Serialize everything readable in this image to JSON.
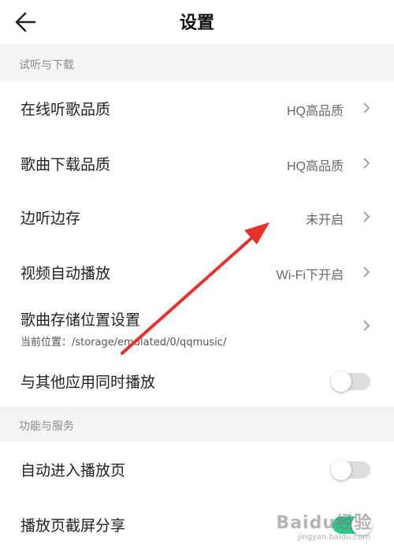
{
  "header": {
    "back_icon": "arrow-left-icon",
    "title": "设置"
  },
  "sections": [
    {
      "label": "试听与下载",
      "items": [
        {
          "label": "在线听歌品质",
          "value": "HQ高品质",
          "control": "chevron"
        },
        {
          "label": "歌曲下载品质",
          "value": "HQ高品质",
          "control": "chevron"
        },
        {
          "label": "边听边存",
          "value": "未开启",
          "control": "chevron"
        },
        {
          "label": "视频自动播放",
          "value": "Wi-Fi下开启",
          "control": "chevron"
        },
        {
          "label": "歌曲存储位置设置",
          "sublabel": "当前位置：/storage/emulated/0/qqmusic/",
          "control": "chevron"
        },
        {
          "label": "与其他应用同时播放",
          "control": "toggle",
          "on": false
        }
      ]
    },
    {
      "label": "功能与服务",
      "items": [
        {
          "label": "自动进入播放页",
          "control": "toggle",
          "on": false
        },
        {
          "label": "播放页截屏分享",
          "control": "toggle",
          "on": true
        }
      ]
    }
  ],
  "colors": {
    "toggle_on": "#2ec88a",
    "toggle_off": "#dddddd",
    "annotation": "#e8312c"
  },
  "watermark": {
    "text": "Baidu经验",
    "sub": "jingyan.baidu.com"
  }
}
